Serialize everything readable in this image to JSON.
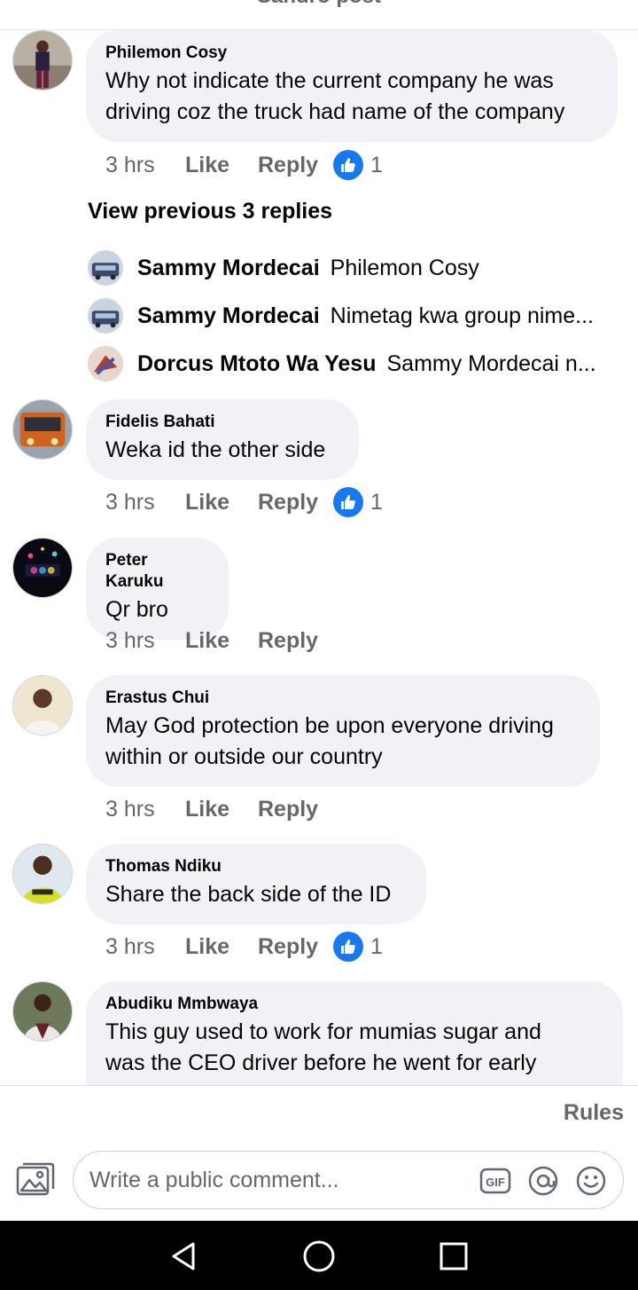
{
  "header": {
    "title": "Sandro post"
  },
  "comments": [
    {
      "author": "Philemon Cosy",
      "text_lines": [
        "Why not indicate the current company he was",
        "driving coz the truck had name of the company"
      ],
      "time": "3 hrs",
      "like_label": "Like",
      "reply_label": "Reply",
      "reaction_count": "1"
    },
    {
      "author": "Fidelis Bahati",
      "text_lines": [
        "Weka id the other side"
      ],
      "time": "3 hrs",
      "like_label": "Like",
      "reply_label": "Reply",
      "reaction_count": "1"
    },
    {
      "author": "Peter Karuku",
      "text_lines": [
        "Qr bro"
      ],
      "time": "3 hrs",
      "like_label": "Like",
      "reply_label": "Reply"
    },
    {
      "author": "Erastus Chui",
      "text_lines": [
        "May God protection be upon everyone driving",
        "within or outside our country"
      ],
      "time": "3 hrs",
      "like_label": "Like",
      "reply_label": "Reply"
    },
    {
      "author": "Thomas Ndiku",
      "text_lines": [
        "Share the back side of the ID"
      ],
      "time": "3 hrs",
      "like_label": "Like",
      "reply_label": "Reply",
      "reaction_count": "1"
    },
    {
      "author": "Abudiku Mmbwaya",
      "text_lines": [
        "This guy used to work for mumias sugar and",
        "was the CEO driver before he went for early"
      ]
    }
  ],
  "replies": {
    "view_previous": "View previous 3 replies",
    "items": [
      {
        "author": "Sammy Mordecai",
        "text": "Philemon Cosy"
      },
      {
        "author": "Sammy Mordecai",
        "text": "Nimetag kwa group nime..."
      },
      {
        "author": "Dorcus Mtoto Wa Yesu",
        "text": "Sammy Mordecai n..."
      }
    ]
  },
  "footer": {
    "rules_label": "Rules",
    "comment_placeholder": "Write a public comment...",
    "gif_label": "GIF",
    "mention_icon": "at-icon",
    "emoji_icon": "smiley-icon",
    "photo_icon": "photo-icon"
  },
  "nav": {
    "back_icon": "back-triangle-icon",
    "home_icon": "home-circle-icon",
    "recents_icon": "recents-square-icon"
  },
  "colors": {
    "reaction_blue": "#1877f2",
    "bubble_bg": "#f0f2f5",
    "secondary_text": "#65676b"
  }
}
